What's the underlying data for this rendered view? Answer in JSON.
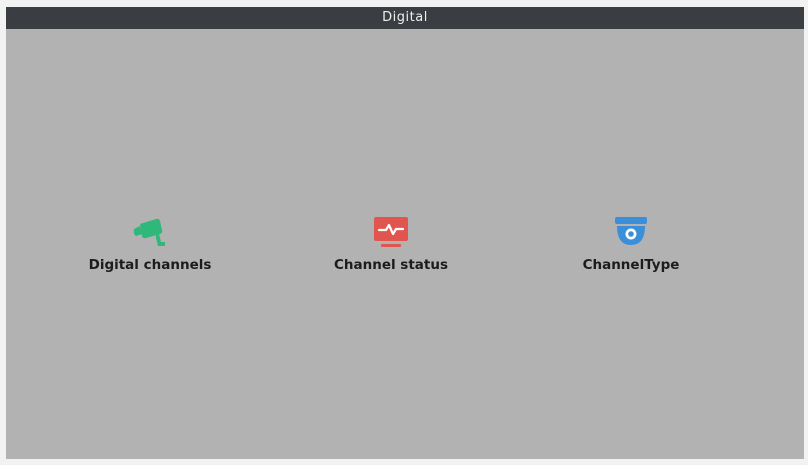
{
  "window": {
    "title": "Digital"
  },
  "menu": {
    "items": [
      {
        "label": "Digital channels",
        "icon": "camera-icon",
        "color": "#2fb87a"
      },
      {
        "label": "Channel status",
        "icon": "monitor-pulse-icon",
        "color": "#e0564e"
      },
      {
        "label": "ChannelType",
        "icon": "dome-camera-icon",
        "color": "#3b8fd9"
      }
    ]
  }
}
